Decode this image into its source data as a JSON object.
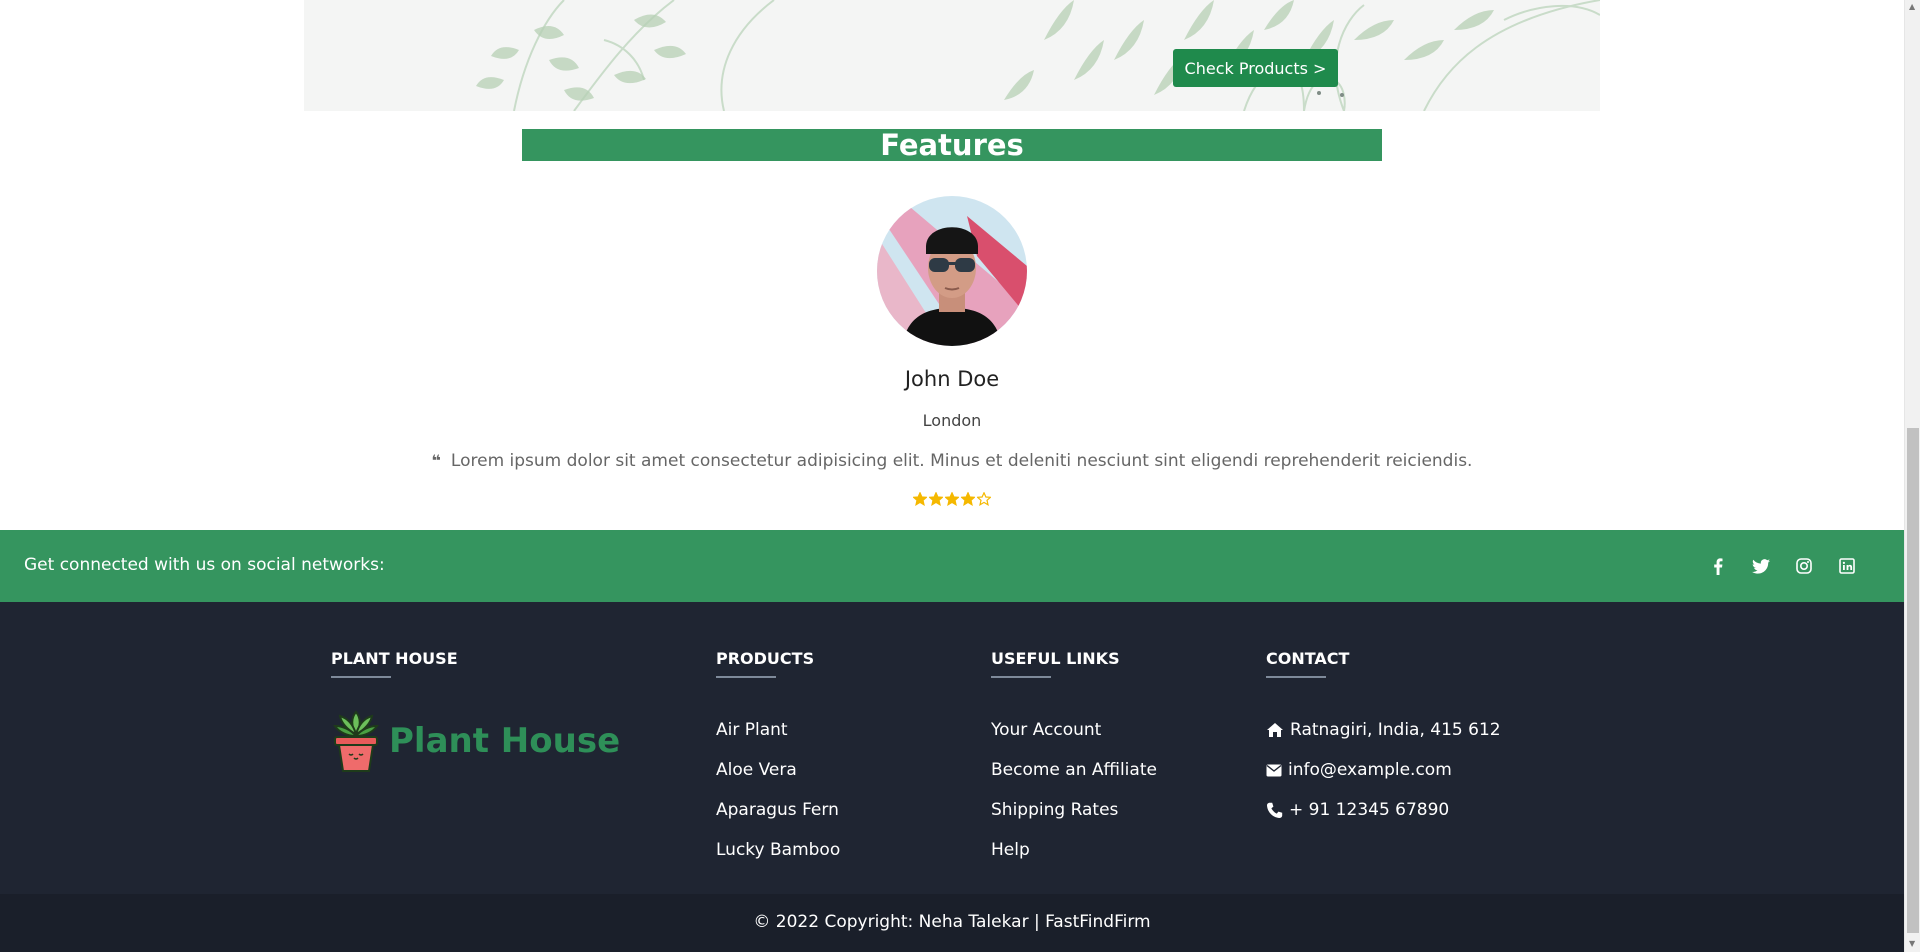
{
  "hero": {
    "button_label": "Check Products >"
  },
  "features": {
    "title": "Features",
    "testimonial": {
      "name": "John Doe",
      "city": "London",
      "quote": "Lorem ipsum dolor sit amet consectetur adipisicing elit. Minus et deleniti nesciunt sint eligendi reprehenderit reiciendis.",
      "rating": 4,
      "max_rating": 5
    }
  },
  "social": {
    "text": "Get connected with us on social networks:",
    "icons": [
      "facebook-icon",
      "twitter-icon",
      "instagram-icon",
      "linkedin-icon"
    ]
  },
  "footer": {
    "brand": {
      "heading": "PLANT HOUSE",
      "logo_text": "Plant House"
    },
    "products": {
      "heading": "PRODUCTS",
      "items": [
        "Air Plant",
        "Aloe Vera",
        "Aparagus Fern",
        "Lucky Bamboo"
      ]
    },
    "useful_links": {
      "heading": "USEFUL LINKS",
      "items": [
        "Your Account",
        "Become an Affiliate",
        "Shipping Rates",
        "Help"
      ]
    },
    "contact": {
      "heading": "CONTACT",
      "address": "Ratnagiri, India, 415 612",
      "email": "info@example.com",
      "phone": "+ 91 12345 67890"
    },
    "copyright": "© 2022 Copyright: Neha Talekar | FastFindFirm"
  },
  "colors": {
    "brand_green": "#35955f",
    "button_green": "#1f8a4c",
    "footer_bg": "#1f2532",
    "star": "#f5b800"
  }
}
